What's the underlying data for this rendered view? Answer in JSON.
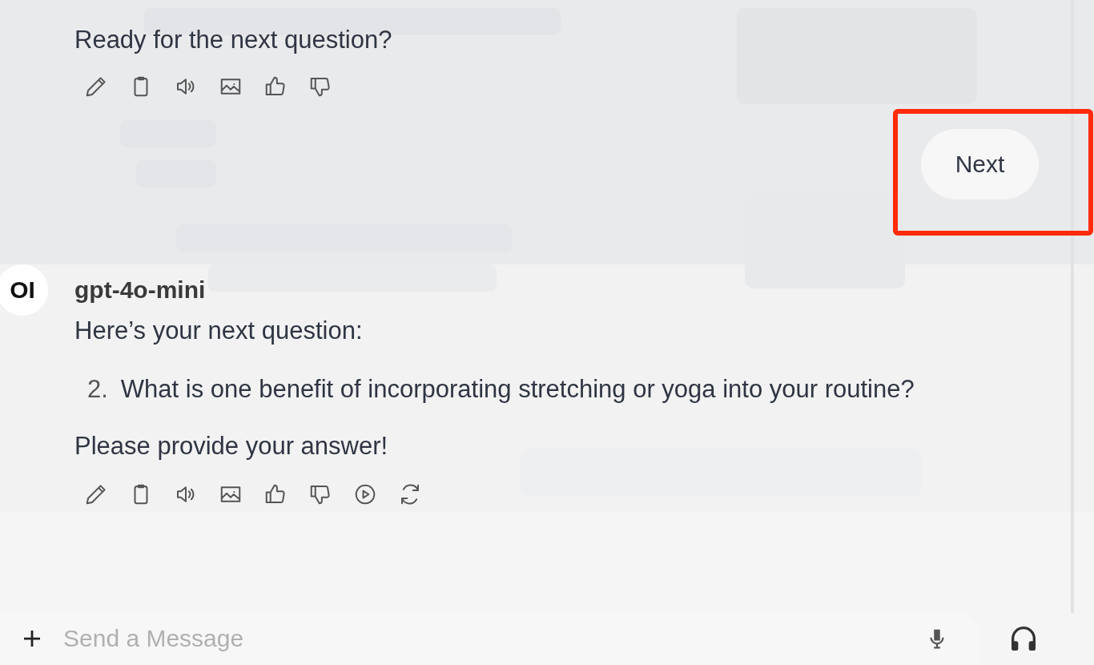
{
  "top_message": {
    "text": "Ready for the next question?",
    "latest": false
  },
  "user_message": {
    "text": "Next",
    "highlighted": true
  },
  "reply": {
    "avatar": "OI",
    "model": "gpt-4o-mini",
    "intro": "Here’s your next question:",
    "list": [
      {
        "number": "2.",
        "text": "What is one benefit of incorporating stretching or yoga into your routine?"
      }
    ],
    "outro": "Please provide your answer!",
    "latest": true
  },
  "composer": {
    "placeholder": "Send a Message"
  }
}
